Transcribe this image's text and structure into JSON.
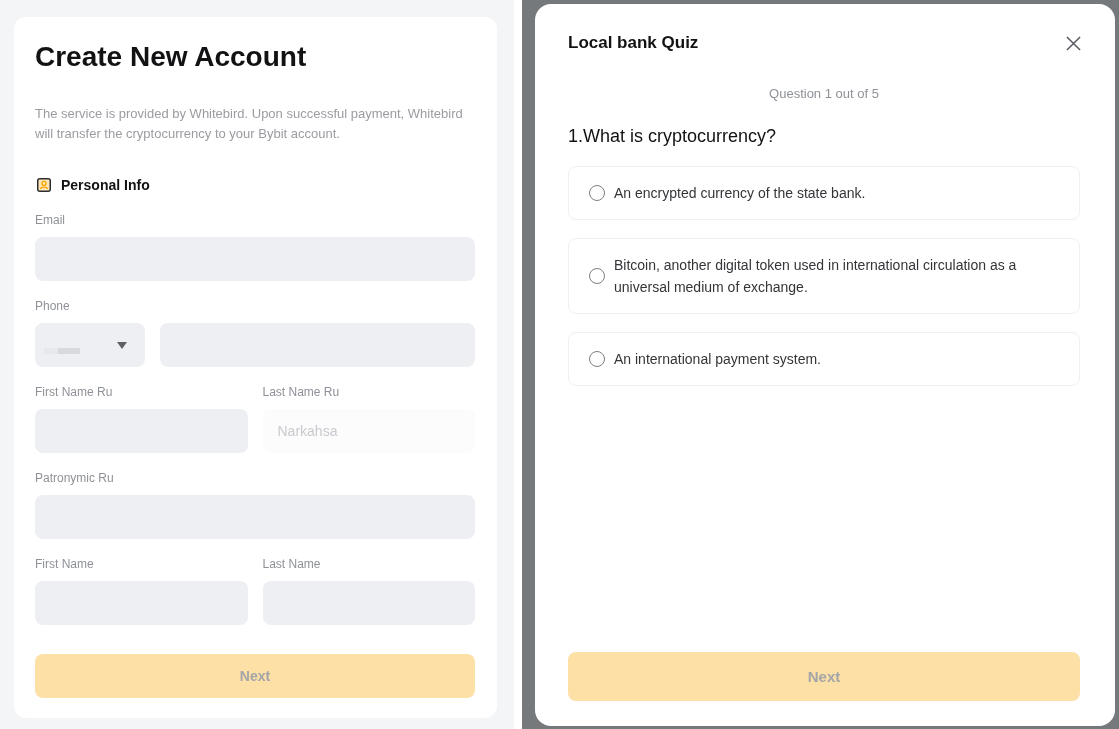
{
  "account_form": {
    "title": "Create New Account",
    "description": "The service is provided by Whitebird. Upon successful payment, Whitebird will transfer the cryptocurrency to your Bybit account.",
    "section_title": "Personal Info",
    "rows": [
      {
        "fields": [
          {
            "label": "Email",
            "kind": "text",
            "disabled": false
          }
        ]
      },
      {
        "fields": [
          {
            "label": "Phone",
            "kind": "phone",
            "disabled": false
          }
        ]
      },
      {
        "fields": [
          {
            "label": "First Name Ru",
            "kind": "text",
            "disabled": false
          },
          {
            "label": "Last Name Ru",
            "kind": "text",
            "disabled": true,
            "placeholder": "Narkahsa"
          }
        ]
      },
      {
        "fields": [
          {
            "label": "Patronymic Ru",
            "kind": "text",
            "disabled": false
          }
        ]
      },
      {
        "fields": [
          {
            "label": "First Name",
            "kind": "text",
            "disabled": false
          },
          {
            "label": "Last Name",
            "kind": "text",
            "disabled": false
          }
        ]
      }
    ],
    "next_button": {
      "label": "Next",
      "disabled": true
    }
  },
  "quiz_dialog": {
    "title": "Local bank Quiz",
    "counter": "Question 1 out of 5",
    "question": "1.What is cryptocurrency?",
    "options": [
      {
        "label": "An encrypted currency of the state bank.",
        "selected": false
      },
      {
        "label": "Bitcoin, another digital token used in international circulation as a universal medium of exchange.",
        "selected": false
      },
      {
        "label": "An international payment system.",
        "selected": false
      }
    ],
    "next_button": {
      "label": "Next",
      "disabled": true
    }
  }
}
